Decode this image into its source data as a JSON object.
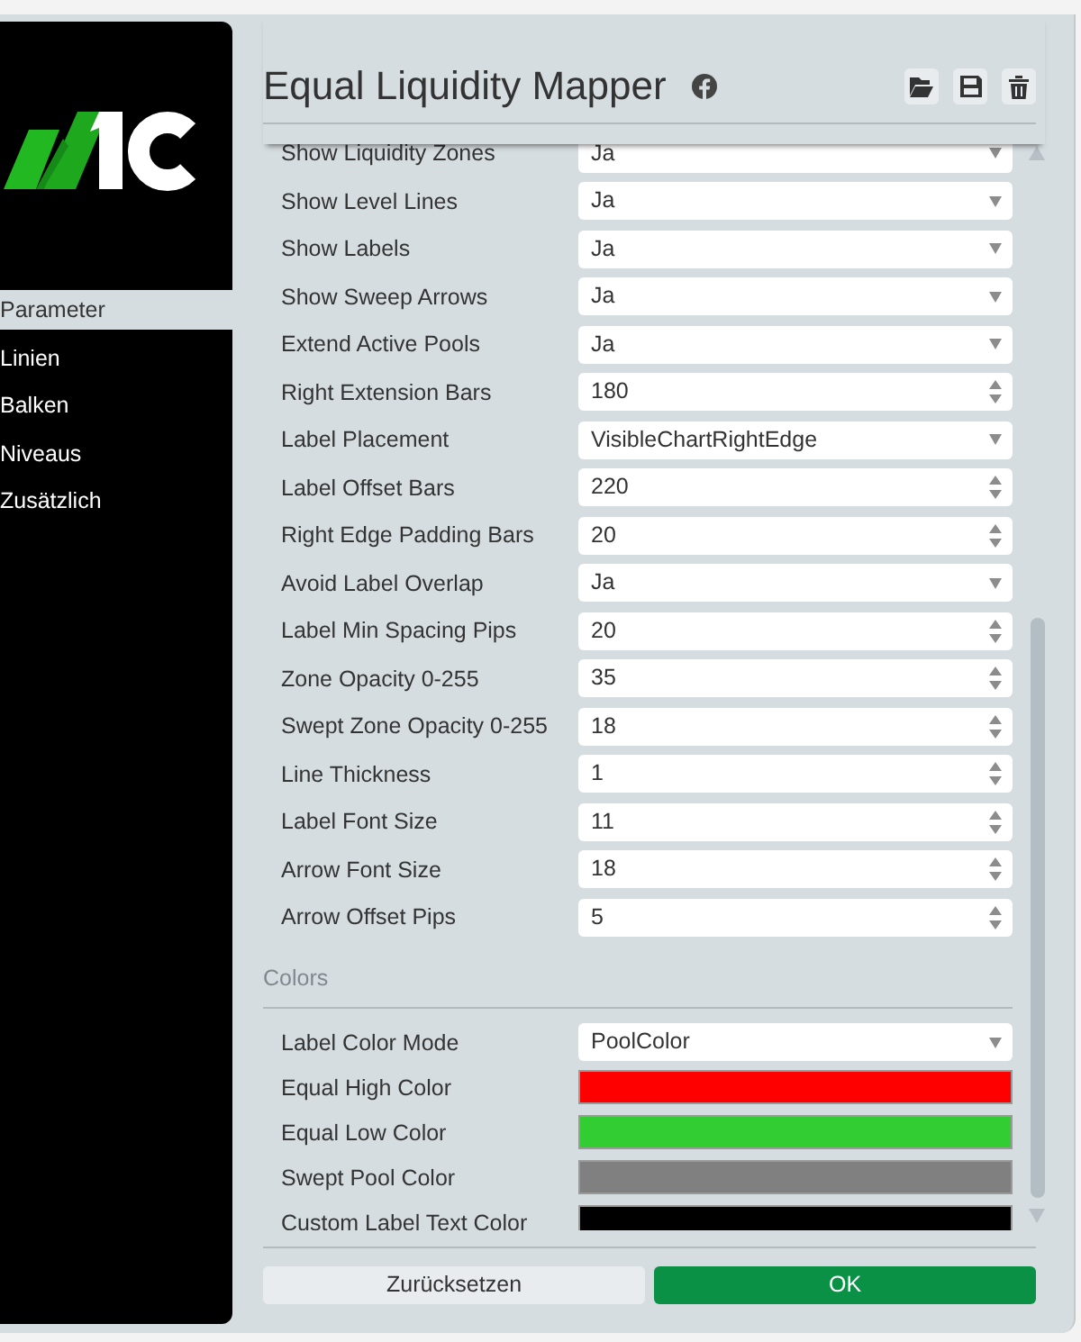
{
  "sidebar": {
    "items": [
      {
        "label": "Parameter",
        "selected": true
      },
      {
        "label": "Linien",
        "selected": false
      },
      {
        "label": "Balken",
        "selected": false
      },
      {
        "label": "Niveaus",
        "selected": false
      },
      {
        "label": "Zusätzlich",
        "selected": false
      }
    ]
  },
  "header": {
    "title": "Equal Liquidity Mapper"
  },
  "parameters": [
    {
      "label": "Show Liquidity Zones",
      "kind": "select",
      "value": "Ja"
    },
    {
      "label": "Show Level Lines",
      "kind": "select",
      "value": "Ja"
    },
    {
      "label": "Show Labels",
      "kind": "select",
      "value": "Ja"
    },
    {
      "label": "Show Sweep Arrows",
      "kind": "select",
      "value": "Ja"
    },
    {
      "label": "Extend Active Pools",
      "kind": "select",
      "value": "Ja"
    },
    {
      "label": "Right Extension Bars",
      "kind": "number",
      "value": "180"
    },
    {
      "label": "Label Placement",
      "kind": "select",
      "value": "VisibleChartRightEdge"
    },
    {
      "label": "Label Offset Bars",
      "kind": "number",
      "value": "220"
    },
    {
      "label": "Right Edge Padding Bars",
      "kind": "number",
      "value": "20"
    },
    {
      "label": "Avoid Label Overlap",
      "kind": "select",
      "value": "Ja"
    },
    {
      "label": "Label Min Spacing Pips",
      "kind": "number",
      "value": "20"
    },
    {
      "label": "Zone Opacity 0-255",
      "kind": "number",
      "value": "35"
    },
    {
      "label": "Swept Zone Opacity 0-255",
      "kind": "number",
      "value": "18"
    },
    {
      "label": "Line Thickness",
      "kind": "number",
      "value": "1"
    },
    {
      "label": "Label Font Size",
      "kind": "number",
      "value": "11"
    },
    {
      "label": "Arrow Font Size",
      "kind": "number",
      "value": "18"
    },
    {
      "label": "Arrow Offset Pips",
      "kind": "number",
      "value": "5"
    }
  ],
  "colors": {
    "heading": "Colors",
    "rows": [
      {
        "label": "Label Color Mode",
        "kind": "select",
        "value": "PoolColor"
      },
      {
        "label": "Equal High Color",
        "kind": "color",
        "color": "#ff0000"
      },
      {
        "label": "Equal Low Color",
        "kind": "color",
        "color": "#32cd32"
      },
      {
        "label": "Swept Pool Color",
        "kind": "color",
        "color": "#808080"
      },
      {
        "label": "Custom Label Text Color",
        "kind": "color",
        "color": "#000000"
      }
    ]
  },
  "buttons": [
    {
      "label": "Zurücksetzen",
      "kind": "secondary"
    },
    {
      "label": "OK",
      "kind": "primary"
    }
  ]
}
